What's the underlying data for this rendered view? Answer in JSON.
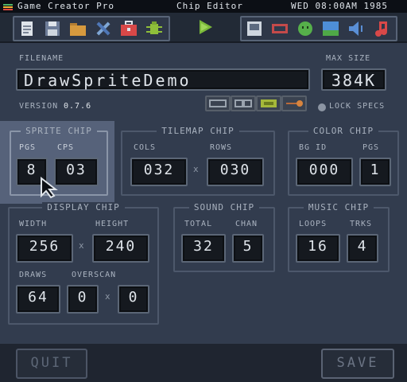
{
  "menubar": {
    "app_name": "Game Creator Pro",
    "window_title": "Chip Editor",
    "clock": "WED 08:00AM 1985"
  },
  "toolbar": {
    "left_icons": [
      "new-file-icon",
      "save-disk-icon",
      "folder-icon",
      "tools-icon",
      "toolbox-icon",
      "bug-icon"
    ],
    "run_icon": "play-icon",
    "right_icons": [
      "computer-icon",
      "screen-icon",
      "sprite-icon",
      "map-icon",
      "sound-icon",
      "music-icon"
    ]
  },
  "filename": {
    "label": "FILENAME",
    "value": "DrawSpriteDemo"
  },
  "max_size": {
    "label": "MAX SIZE",
    "value": "384K"
  },
  "version": {
    "label": "VERSION",
    "value": "0.7.6"
  },
  "lock_specs": {
    "label": "LOCK SPECS",
    "checked": false
  },
  "sprite_chip": {
    "title": "SPRITE CHIP",
    "pgs_label": "PGS",
    "pgs_value": "8",
    "cps_label": "CPS",
    "cps_value": "03"
  },
  "tilemap_chip": {
    "title": "TILEMAP CHIP",
    "cols_label": "COLS",
    "cols_value": "032",
    "rows_label": "ROWS",
    "rows_value": "030",
    "times": "x"
  },
  "color_chip": {
    "title": "COLOR CHIP",
    "bgid_label": "BG ID",
    "bgid_value": "000",
    "pgs_label": "PGS",
    "pgs_value": "1"
  },
  "display_chip": {
    "title": "DISPLAY CHIP",
    "width_label": "WIDTH",
    "width_value": "256",
    "height_label": "HEIGHT",
    "height_value": "240",
    "draws_label": "DRAWS",
    "draws_value": "64",
    "overscan_label": "OVERSCAN",
    "overscan_x_value": "0",
    "overscan_y_value": "0",
    "times": "x"
  },
  "sound_chip": {
    "title": "SOUND CHIP",
    "total_label": "TOTAL",
    "total_value": "32",
    "chan_label": "CHAN",
    "chan_value": "5"
  },
  "music_chip": {
    "title": "MUSIC CHIP",
    "loops_label": "LOOPS",
    "loops_value": "16",
    "trks_label": "TRKS",
    "trks_value": "4"
  },
  "buttons": {
    "quit": "QUIT",
    "save": "SAVE"
  },
  "colors": {
    "background": "#323c4e",
    "field_bg": "#15191f",
    "selected_panel": "#56627a",
    "text": "#dfe4ea"
  }
}
